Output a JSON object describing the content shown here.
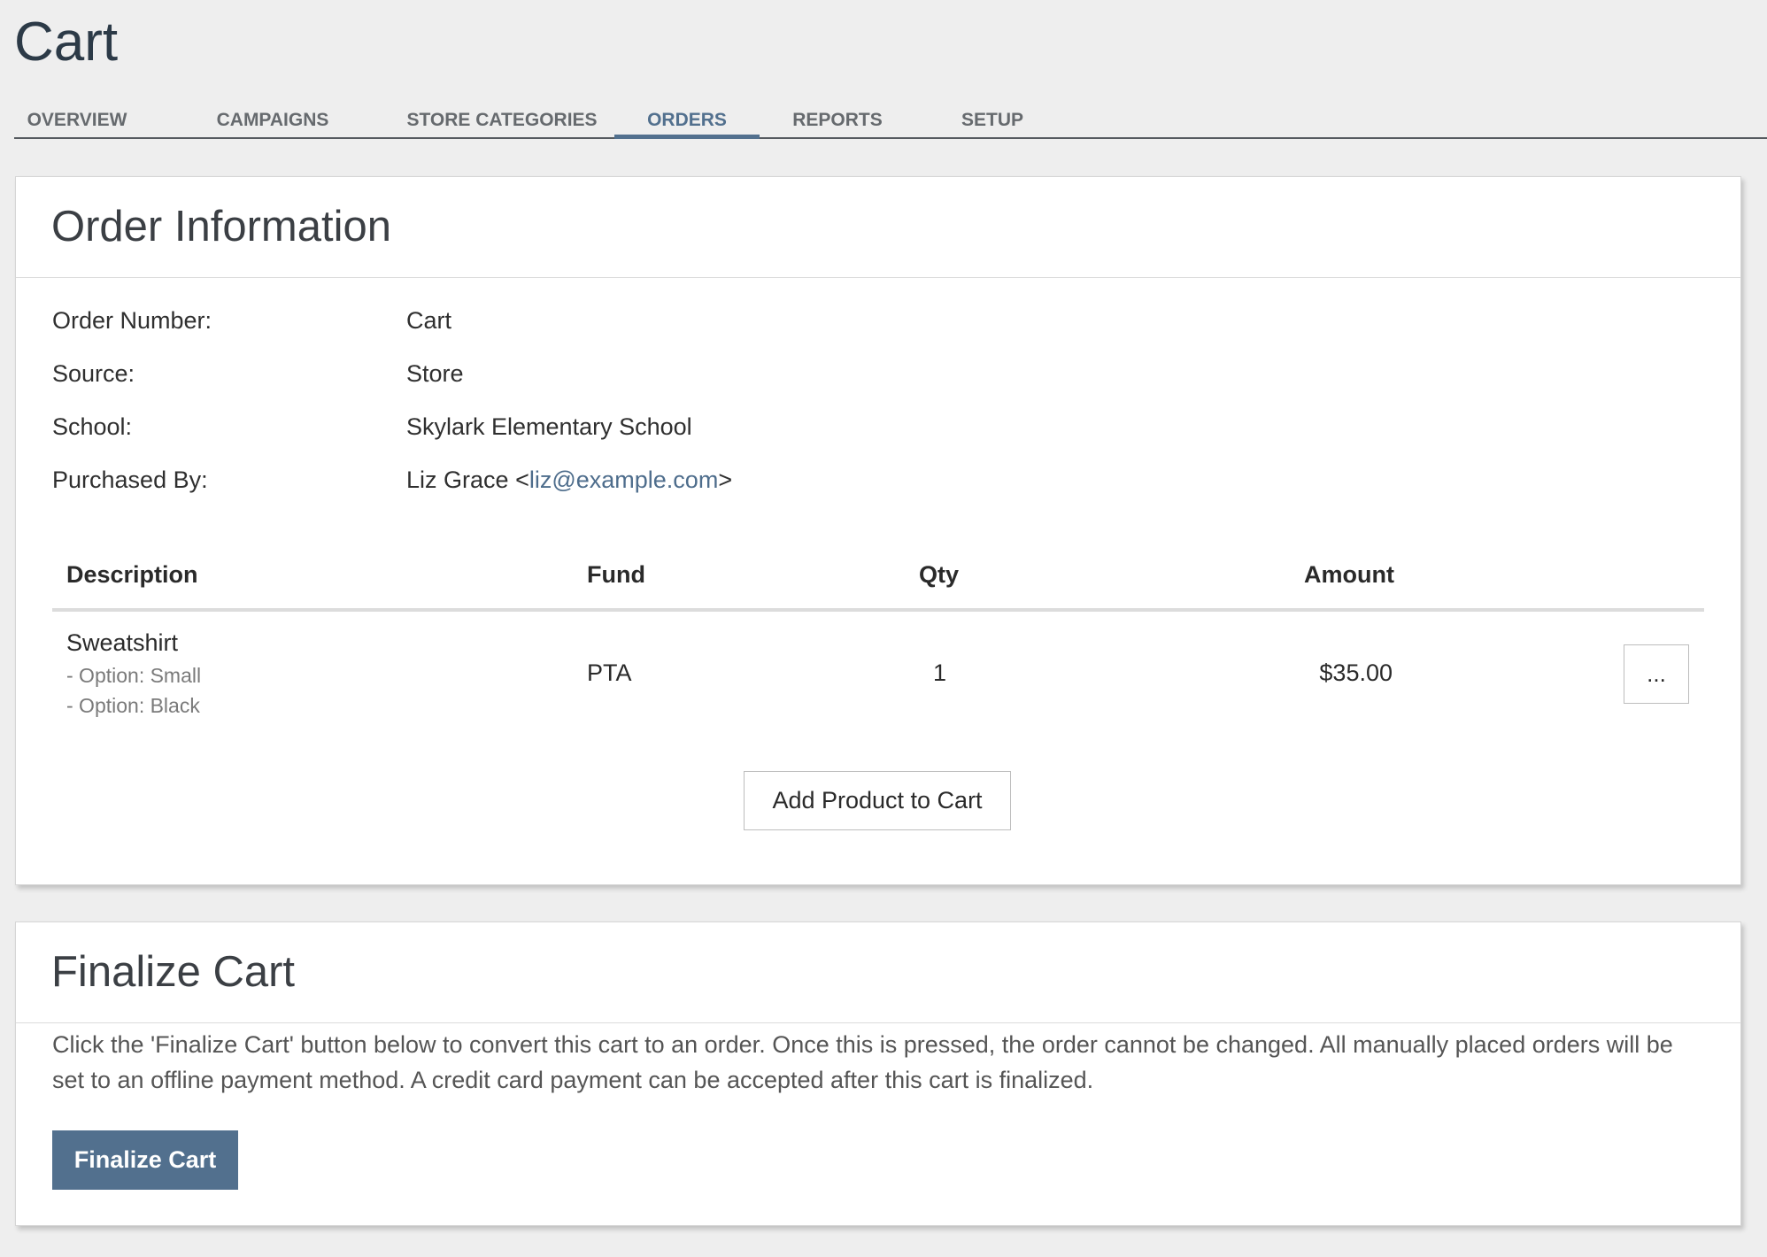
{
  "page": {
    "title": "Cart"
  },
  "tabs": [
    {
      "label": "OVERVIEW",
      "active": false
    },
    {
      "label": "CAMPAIGNS",
      "active": false
    },
    {
      "label": "STORE CATEGORIES",
      "active": false
    },
    {
      "label": "ORDERS",
      "active": true
    },
    {
      "label": "REPORTS",
      "active": false
    },
    {
      "label": "SETUP",
      "active": false
    }
  ],
  "order_info": {
    "title": "Order Information",
    "fields": [
      {
        "label": "Order Number:",
        "value": "Cart"
      },
      {
        "label": "Source:",
        "value": "Store"
      },
      {
        "label": "School:",
        "value": "Skylark Elementary School"
      },
      {
        "label": "Purchased By:",
        "value": "Liz Grace"
      }
    ],
    "purchaser": {
      "name": "Liz Grace",
      "open_bracket": "<",
      "email": "liz@example.com",
      "close_bracket": ">"
    },
    "table": {
      "headers": {
        "description": "Description",
        "fund": "Fund",
        "qty": "Qty",
        "amount": "Amount"
      },
      "rows": [
        {
          "description": "Sweatshirt",
          "options": [
            "- Option: Small",
            "- Option: Black"
          ],
          "fund": "PTA",
          "qty": "1",
          "amount": "$35.00",
          "actions_label": "..."
        }
      ]
    },
    "add_product_label": "Add Product to Cart"
  },
  "finalize": {
    "title": "Finalize Cart",
    "description": "Click the 'Finalize Cart' button below to convert this cart to an order. Once this is pressed, the order cannot be changed. All manually placed orders will be set to an offline payment method. A credit card payment can be accepted after this cart is finalized.",
    "button_label": "Finalize Cart"
  },
  "colors": {
    "accent": "#52708e",
    "background": "#eeeeee",
    "link": "#4e6d8c"
  }
}
